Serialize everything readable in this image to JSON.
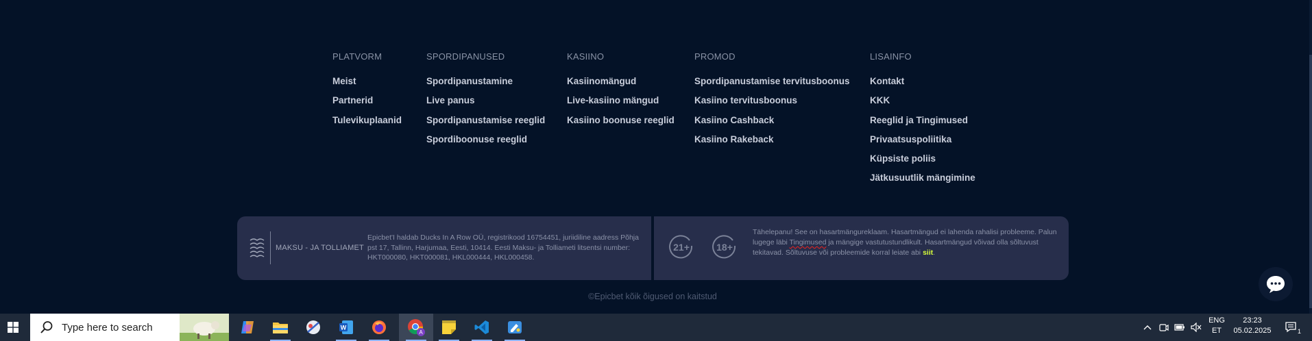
{
  "footer": {
    "columns": [
      {
        "heading": "PLATVORM",
        "links": [
          "Meist",
          "Partnerid",
          "Tulevikuplaanid"
        ]
      },
      {
        "heading": "SPORDIPANUSED",
        "links": [
          "Spordipanustamine",
          "Live panus",
          "Spordipanustamise reeglid",
          "Spordiboonuse reeglid"
        ]
      },
      {
        "heading": "KASIINO",
        "links": [
          "Kasiinomängud",
          "Live-kasiino mängud",
          "Kasiino boonuse reeglid"
        ]
      },
      {
        "heading": "PROMOD",
        "links": [
          "Spordipanustamise tervitusboonus",
          "Kasiino tervitusboonus",
          "Kasiino Cashback",
          "Kasiino Rakeback"
        ]
      },
      {
        "heading": "LISAINFO",
        "links": [
          "Kontakt",
          "KKK",
          "Reeglid ja Tingimused",
          "Privaatsuspoliitika",
          "Küpsiste poliis",
          "Jätkusuutlik mängimine"
        ]
      }
    ],
    "license": {
      "authority": "MAKSU - JA TOLLIAMET",
      "text": "Epicbet'I haldab Ducks In A Row OÜ, registrikood 16754451, juriidiline aadress Põhja pst 17, Tallinn, Harjumaa, Eesti, 10414. Eesti Maksu- ja Tolliameti litsentsi number: HKT000080, HKT000081, HKL000444, HKL000458."
    },
    "warning": {
      "age_badges": [
        "21+",
        "18+"
      ],
      "text_before": "Tähelepanu! See on hasartmängureklaam. Hasartmängud ei lahenda rahalisi probleeme. Palun lugege läbi ",
      "squiggle_word": "Tingimused",
      "text_after": " ja mängige vastutustundlikult. Hasartmängud võivad olla sõltuvust tekitavad. Sõltuvuse või probleemide korral leiate abi ",
      "link_text": "siit",
      "end": "."
    },
    "copyright": "©Epicbet kõik õigused on kaitstud"
  },
  "taskbar": {
    "search_placeholder": "Type here to search",
    "apps": [
      "copilot-icon",
      "file-explorer-icon",
      "snipping-tool-icon",
      "word-icon",
      "firefox-icon",
      "chrome-icon",
      "sticky-notes-icon",
      "vscode-icon",
      "paint-icon"
    ],
    "language": {
      "line1": "ENG",
      "line2": "ET"
    },
    "time": "23:23",
    "date": "05.02.2025",
    "notification_count": "1"
  },
  "colors": {
    "page_bg": "#041227",
    "box_bg": "#272e4b",
    "accent_green": "#d7ff3a",
    "taskbar_bg": "#1f2a3a"
  }
}
